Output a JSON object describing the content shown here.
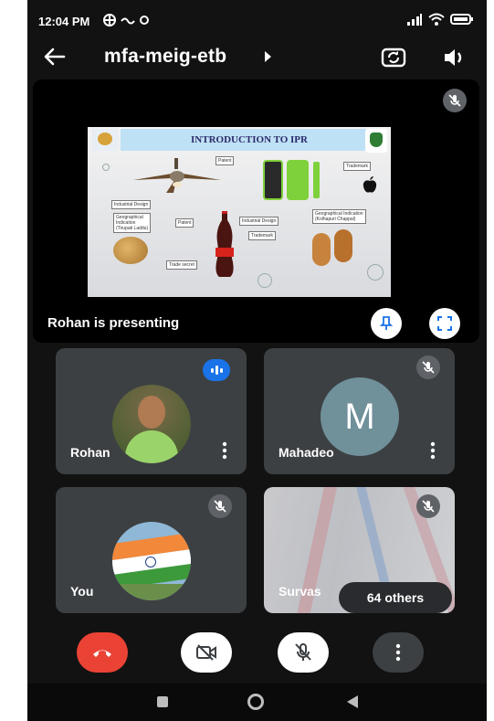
{
  "status_bar": {
    "time": "12:04 PM"
  },
  "header": {
    "meeting_code": "mfa-meig-etb"
  },
  "presentation": {
    "presenter_text": "Rohan is presenting",
    "slide": {
      "title": "INTRODUCTION TO IPR",
      "labels": {
        "patent_top": "Patent",
        "trademark_right": "Trademark",
        "industrial_design": "Industrial Design",
        "geo_indication_left": "Geographical\nIndication\n(Tirupati Laddu)",
        "patent_mid": "Patent",
        "industrial_design_mid": "Industrial Design",
        "trademark_mid": "Trademark",
        "geo_indication_right": "Geographical Indication\n(Kolhapuri Chappal)",
        "trade_secret": "Trade secret"
      }
    }
  },
  "participants": [
    {
      "name": "Rohan"
    },
    {
      "name": "Mahadeo",
      "initial": "M"
    },
    {
      "name": "You"
    },
    {
      "name": "Survas",
      "others_label": "64 others"
    }
  ],
  "colors": {
    "background": "#121212",
    "tile": "#3c4043",
    "end_call": "#ea4335",
    "accent_blue": "#1a73e8",
    "avatar_m": "#70909a"
  }
}
